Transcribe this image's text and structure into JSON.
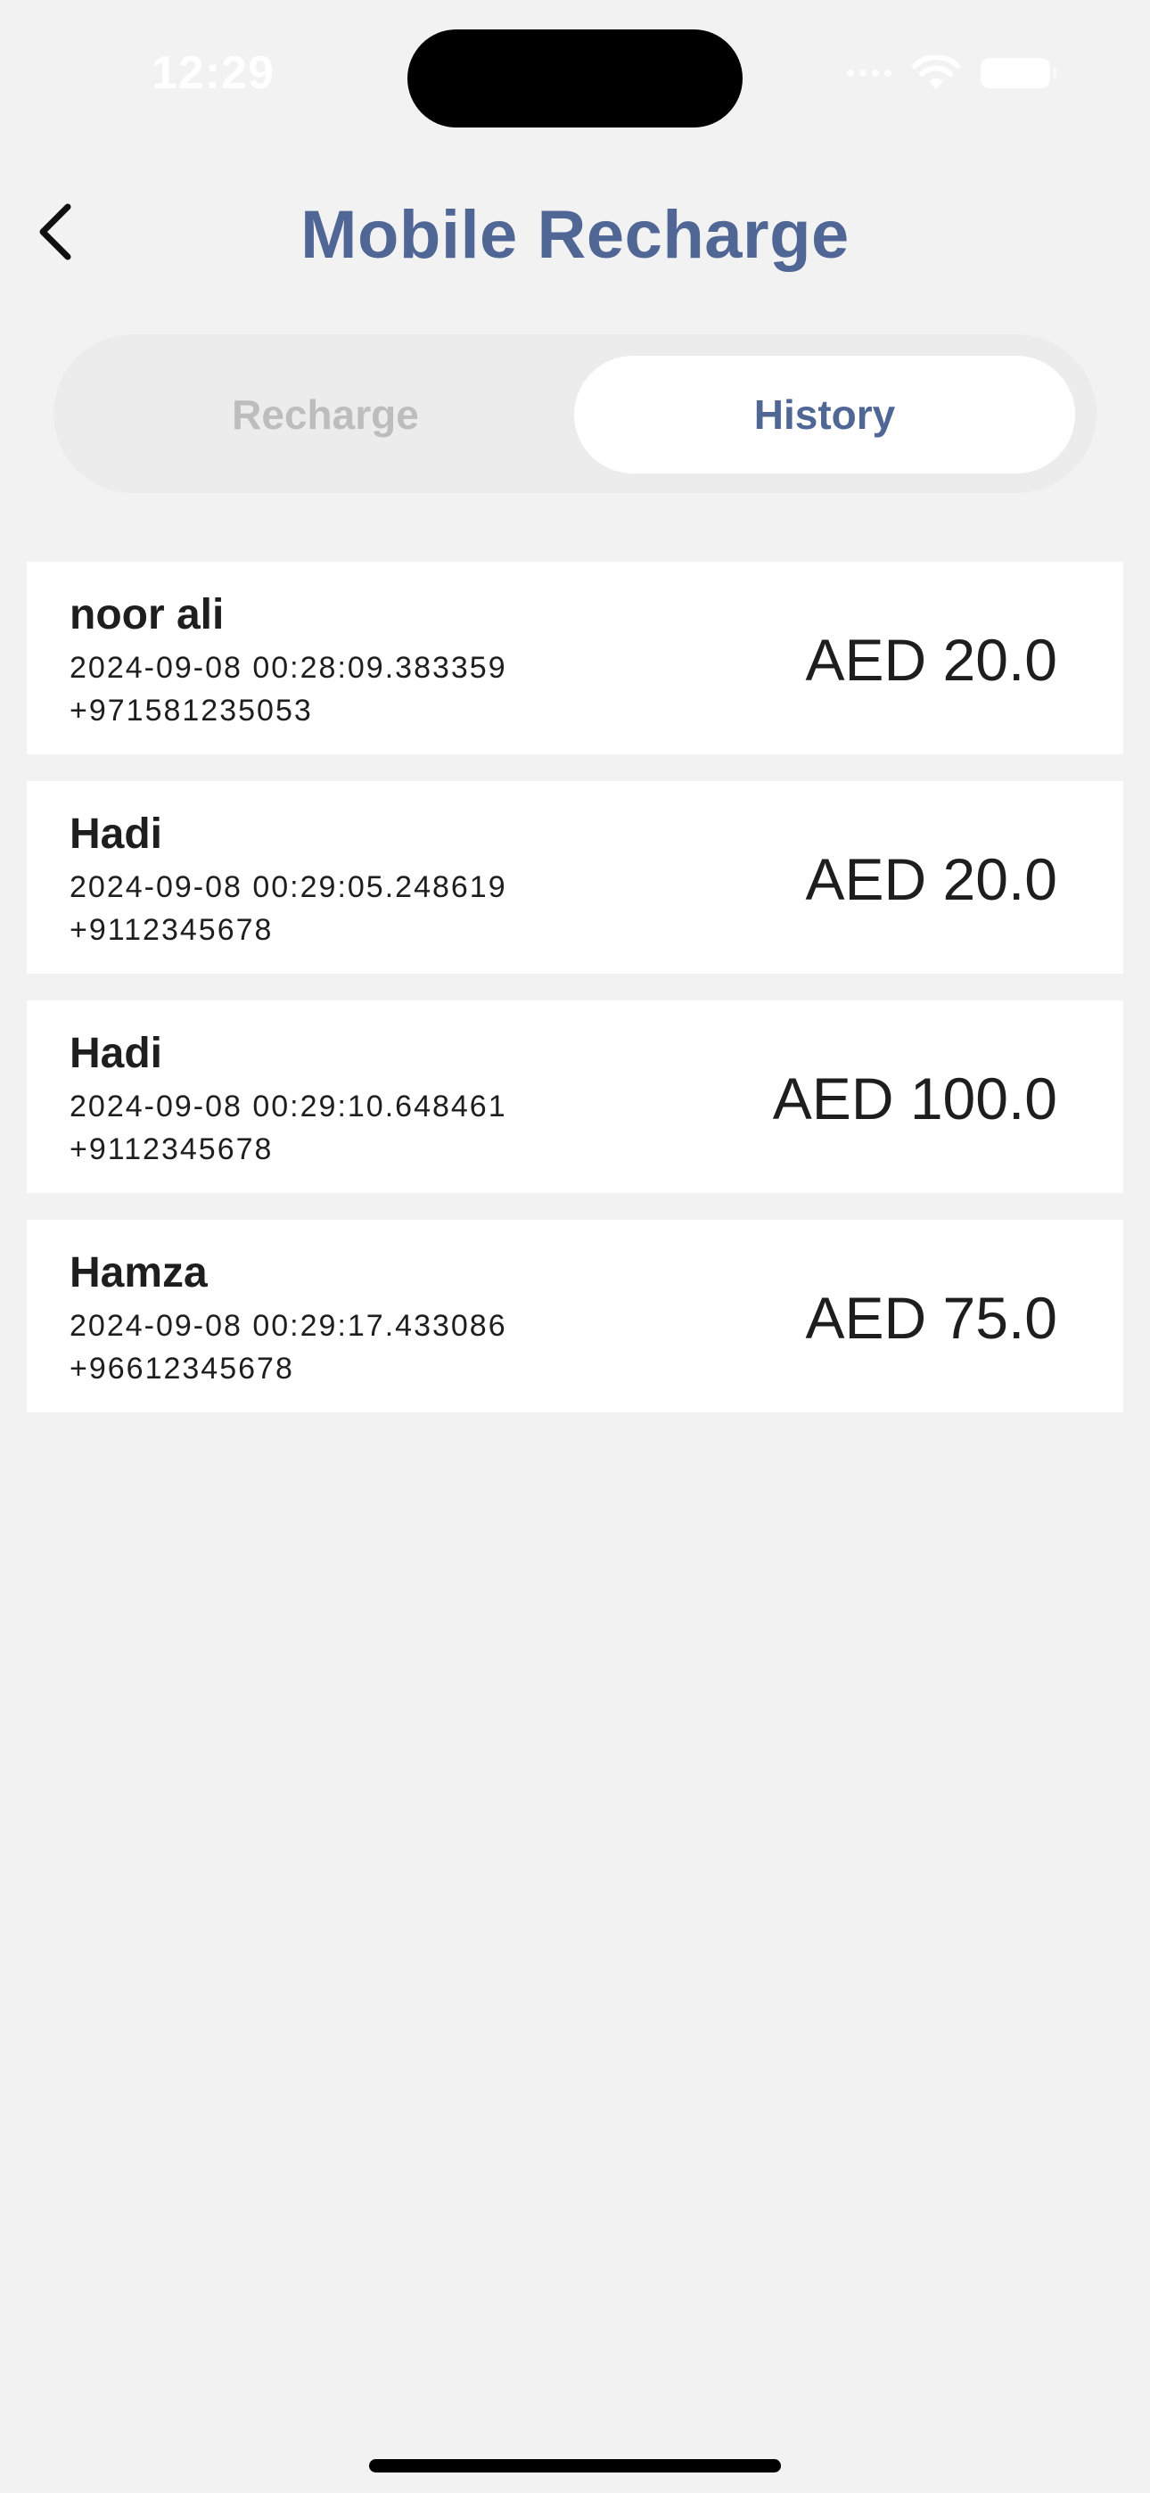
{
  "status_bar": {
    "time": "12:29"
  },
  "header": {
    "back_icon": "chevron-left-icon",
    "title": "Mobile Recharge"
  },
  "tabs": [
    {
      "label": "Recharge",
      "active": false
    },
    {
      "label": "History",
      "active": true
    }
  ],
  "history": [
    {
      "name": "noor ali",
      "date": "2024-09-08 00:28:09.383359",
      "phone": "+971581235053",
      "amount": "AED 20.0"
    },
    {
      "name": "Hadi",
      "date": "2024-09-08 00:29:05.248619",
      "phone": "+9112345678",
      "amount": "AED 20.0"
    },
    {
      "name": "Hadi",
      "date": "2024-09-08 00:29:10.648461",
      "phone": "+9112345678",
      "amount": "AED 100.0"
    },
    {
      "name": "Hamza",
      "date": "2024-09-08 00:29:17.433086",
      "phone": "+96612345678",
      "amount": "AED 75.0"
    }
  ],
  "colors": {
    "accent": "#506796",
    "background": "#f2f2f2",
    "inactive_tab_text": "#bdbdbd"
  }
}
